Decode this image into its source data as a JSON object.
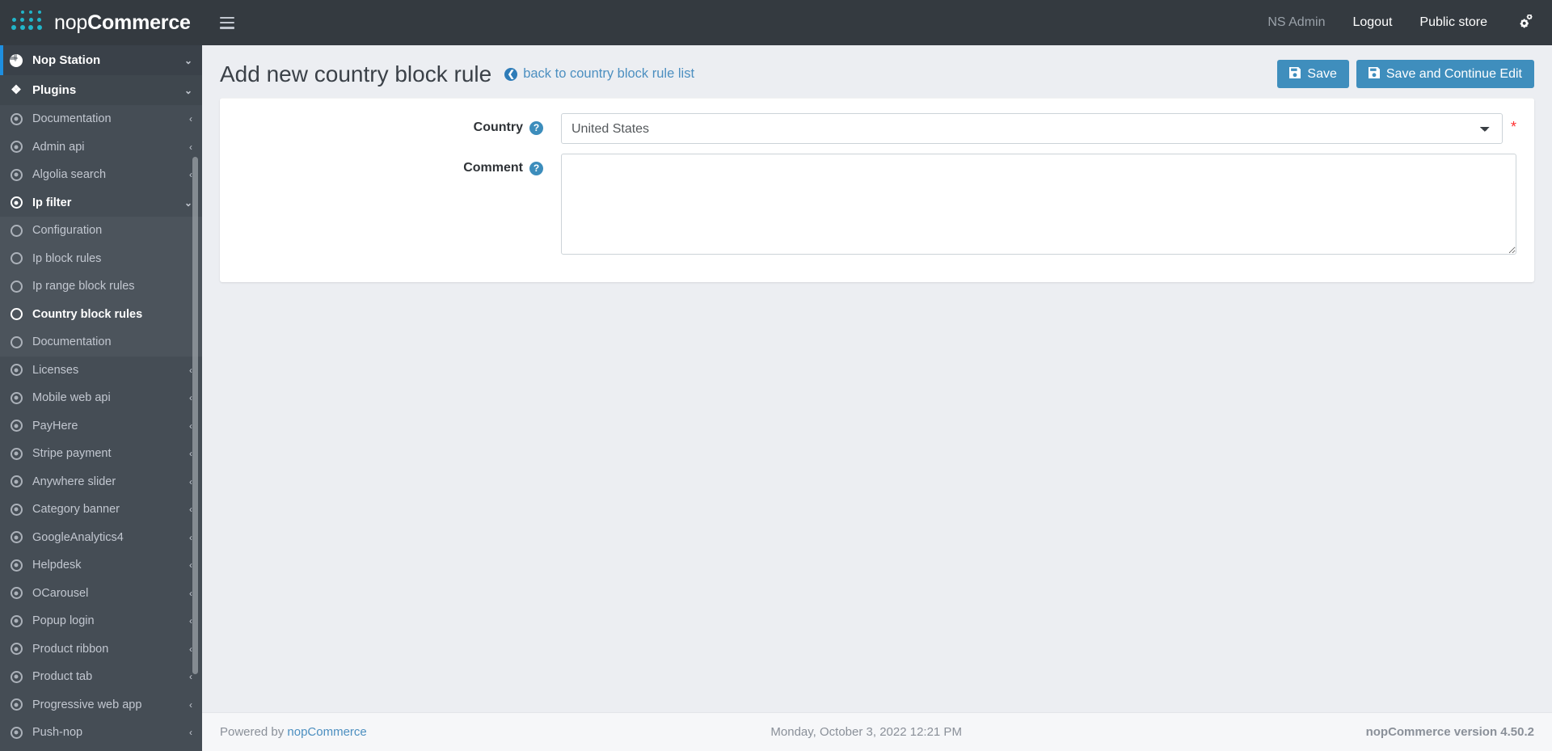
{
  "brand": {
    "name_light": "nop",
    "name_bold": "Commerce",
    "logo_icon": "nopcommerce-dots-logo"
  },
  "topbar": {
    "menu_toggle_icon": "hamburger-icon",
    "user_name": "NS Admin",
    "logout_label": "Logout",
    "public_store_label": "Public store",
    "settings_icon": "cogs-icon",
    "settings_glyph": "⚙"
  },
  "sidebar": {
    "scroll_thumb": true,
    "top_items": [
      {
        "label": "Nop Station",
        "icon": "globe-icon",
        "chevron": "⌄",
        "active_accent": true
      },
      {
        "label": "Plugins",
        "icon": "puzzle-piece-icon",
        "glyph": "❖",
        "chevron": "⌄",
        "active_accent": false
      }
    ],
    "plugin_items": [
      {
        "label": "Documentation",
        "icon": "radio-filled-icon",
        "chevron": "‹",
        "active": false
      },
      {
        "label": "Admin api",
        "icon": "radio-filled-icon",
        "chevron": "‹",
        "active": false
      },
      {
        "label": "Algolia search",
        "icon": "radio-filled-icon",
        "chevron": "‹",
        "active": false
      },
      {
        "label": "Ip filter",
        "icon": "radio-filled-icon",
        "chevron": "⌄",
        "active": true
      }
    ],
    "sub_items": [
      {
        "label": "Configuration",
        "icon": "circle-icon",
        "active": false
      },
      {
        "label": "Ip block rules",
        "icon": "circle-icon",
        "active": false
      },
      {
        "label": "Ip range block rules",
        "icon": "circle-icon",
        "active": false
      },
      {
        "label": "Country block rules",
        "icon": "circle-icon",
        "active": true
      },
      {
        "label": "Documentation",
        "icon": "circle-icon",
        "active": false
      }
    ],
    "plugin_items_rest": [
      {
        "label": "Licenses",
        "icon": "radio-filled-icon",
        "chevron": "‹"
      },
      {
        "label": "Mobile web api",
        "icon": "radio-filled-icon",
        "chevron": "‹"
      },
      {
        "label": "PayHere",
        "icon": "radio-filled-icon",
        "chevron": "‹"
      },
      {
        "label": "Stripe payment",
        "icon": "radio-filled-icon",
        "chevron": "‹"
      },
      {
        "label": "Anywhere slider",
        "icon": "radio-filled-icon",
        "chevron": "‹"
      },
      {
        "label": "Category banner",
        "icon": "radio-filled-icon",
        "chevron": "‹"
      },
      {
        "label": "GoogleAnalytics4",
        "icon": "radio-filled-icon",
        "chevron": "‹"
      },
      {
        "label": "Helpdesk",
        "icon": "radio-filled-icon",
        "chevron": "‹"
      },
      {
        "label": "OCarousel",
        "icon": "radio-filled-icon",
        "chevron": "‹"
      },
      {
        "label": "Popup login",
        "icon": "radio-filled-icon",
        "chevron": "‹"
      },
      {
        "label": "Product ribbon",
        "icon": "radio-filled-icon",
        "chevron": "‹"
      },
      {
        "label": "Product tab",
        "icon": "radio-filled-icon",
        "chevron": "‹"
      },
      {
        "label": "Progressive web app",
        "icon": "radio-filled-icon",
        "chevron": "‹"
      },
      {
        "label": "Push-nop",
        "icon": "radio-filled-icon",
        "chevron": "‹"
      }
    ]
  },
  "page": {
    "title": "Add new country block rule",
    "back_link_label": "back to country block rule list",
    "back_link_icon": "arrow-circle-left-icon",
    "back_link_glyph": "❮",
    "save_label": "Save",
    "save_continue_label": "Save and Continue Edit",
    "save_icon": "floppy-disk-icon",
    "save_glyph": "ὋE"
  },
  "form": {
    "country": {
      "label": "Country",
      "help_icon": "question-mark-icon",
      "help_glyph": "?",
      "value": "United States",
      "required": true,
      "required_marker": "*",
      "options": [
        "United States"
      ]
    },
    "comment": {
      "label": "Comment",
      "help_icon": "question-mark-icon",
      "help_glyph": "?",
      "value": "",
      "placeholder": ""
    }
  },
  "footer": {
    "powered_by_prefix": "Powered by ",
    "powered_by_link": "nopCommerce",
    "date": "Monday, October 3, 2022 12:21 PM",
    "version": "nopCommerce version 4.50.2"
  },
  "colors": {
    "brand_teal": "#21b5c9",
    "accent_blue": "#1e8fe0",
    "button_blue": "#3f8ebd",
    "link_blue": "#4c8fc0",
    "sidebar_bg": "#454d55",
    "topbar_bg": "#343a40",
    "required_red": "#ff2f2f"
  }
}
